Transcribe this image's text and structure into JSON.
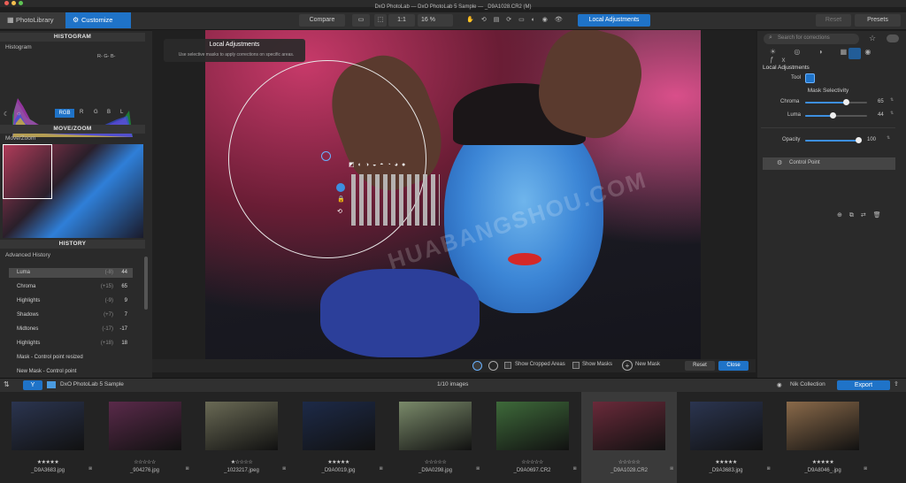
{
  "app": {
    "title": "DxO PhotoLab — DxO PhotoLab 5 Sample — _D9A1028.CR2 (M)"
  },
  "tabs": [
    {
      "label": "PhotoLibrary"
    },
    {
      "label": "Customize"
    }
  ],
  "toolbar": {
    "compare": "Compare",
    "zoom_label": "1:1",
    "zoom_value": "16 %",
    "local_adjustments": "Local Adjustments",
    "reset": "Reset",
    "presets": "Presets"
  },
  "left": {
    "histogram": {
      "title": "HISTOGRAM",
      "sub": "Histogram",
      "channels_label": "R- G- B-",
      "modes": [
        "RGB",
        "R",
        "G",
        "B",
        "L"
      ]
    },
    "movezoom": {
      "title": "MOVE/ZOOM",
      "sub": "Move/Zoom"
    },
    "history": {
      "title": "HISTORY",
      "sub": "Advanced History",
      "rows": [
        {
          "name": "Luma",
          "delta": "(-8)",
          "value": "44"
        },
        {
          "name": "Chroma",
          "delta": "(+15)",
          "value": "65"
        },
        {
          "name": "Highlights",
          "delta": "(-9)",
          "value": "9"
        },
        {
          "name": "Shadows",
          "delta": "(+7)",
          "value": "7"
        },
        {
          "name": "Midtones",
          "delta": "(-17)",
          "value": "-17"
        },
        {
          "name": "Highlights",
          "delta": "(+18)",
          "value": "18"
        },
        {
          "name": "Mask - Control point resized",
          "delta": "",
          "value": ""
        },
        {
          "name": "New Mask - Control point",
          "delta": "",
          "value": ""
        }
      ]
    }
  },
  "tooltip": {
    "title": "Local Adjustments",
    "text": "Use selective masks to apply corrections on specific areas."
  },
  "watermark": {
    "text": "HUABANGSHOU.COM"
  },
  "viewerbar": {
    "show_cropped": "Show Cropped Areas",
    "show_masks": "Show Masks",
    "new_mask": "New Mask",
    "reset": "Reset",
    "close": "Close"
  },
  "right": {
    "search_placeholder": "Search for corrections",
    "section": "Local Adjustments",
    "tool_label": "Tool",
    "mask_selectivity": "Mask Selectivity",
    "chroma": {
      "label": "Chroma",
      "value": "65",
      "fraction": 0.65
    },
    "luma": {
      "label": "Luma",
      "value": "44",
      "fraction": 0.44
    },
    "opacity": {
      "label": "Opacity",
      "value": "100",
      "fraction": 1.0
    },
    "control_point": "Control Point"
  },
  "filmbar": {
    "project": "DxO PhotoLab 5 Sample",
    "count": "1/10 images",
    "nik": "Nik Collection",
    "export": "Export"
  },
  "thumbs": [
    {
      "name": "_D9A3683.jpg",
      "stars": "★★★★★",
      "color": "#2b3550"
    },
    {
      "name": "_904276.jpg",
      "stars": "☆☆☆☆☆",
      "color": "#5a2a4a"
    },
    {
      "name": "_1023217.jpeg",
      "stars": "★☆☆☆☆",
      "color": "#6a6a55"
    },
    {
      "name": "_D9A0019.jpg",
      "stars": "★★★★★",
      "color": "#1d2a48"
    },
    {
      "name": "_D9A0298.jpg",
      "stars": "☆☆☆☆☆",
      "color": "#7a8a6a"
    },
    {
      "name": "_D9A0697.CR2",
      "stars": "☆☆☆☆☆",
      "color": "#3e6a3a"
    },
    {
      "name": "_D9A1028.CR2",
      "stars": "☆☆☆☆☆",
      "color": "#6a2a3a"
    },
    {
      "name": "_D9A3683.jpg",
      "stars": "★★★★★",
      "color": "#2b3550"
    },
    {
      "name": "_D9A8046_.jpg",
      "stars": "★★★★★",
      "color": "#8a6a4a"
    }
  ]
}
